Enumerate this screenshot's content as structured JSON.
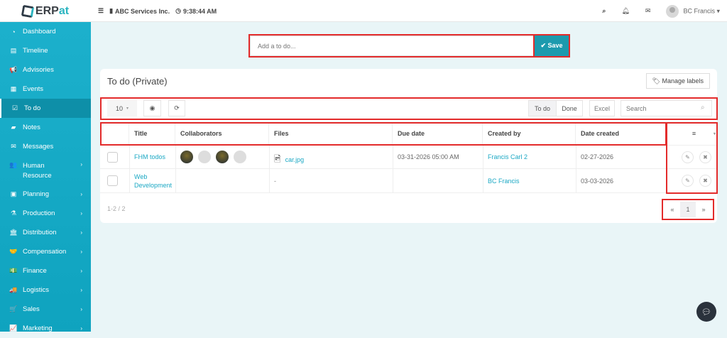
{
  "app": {
    "logo_prefix": "ERP",
    "logo_suffix": "at",
    "company": "ABC Services Inc.",
    "time": "9:38:44 AM",
    "user": "BC Francis"
  },
  "sidebar": {
    "items": [
      {
        "label": "Dashboard",
        "icon": "dashboard-icon",
        "glyph": "◔"
      },
      {
        "label": "Timeline",
        "icon": "timeline-icon",
        "glyph": "▤"
      },
      {
        "label": "Advisories",
        "icon": "megaphone-icon",
        "glyph": "📢"
      },
      {
        "label": "Events",
        "icon": "calendar-icon",
        "glyph": "▦"
      },
      {
        "label": "To do",
        "icon": "check-square-icon",
        "glyph": "☑"
      },
      {
        "label": "Notes",
        "icon": "note-icon",
        "glyph": "▰"
      },
      {
        "label": "Messages",
        "icon": "envelope-icon",
        "glyph": "✉"
      },
      {
        "label": "Human Resource",
        "icon": "users-icon",
        "glyph": "👥"
      },
      {
        "label": "Planning",
        "icon": "briefcase-icon",
        "glyph": "▣"
      },
      {
        "label": "Production",
        "icon": "flask-icon",
        "glyph": "⚗"
      },
      {
        "label": "Distribution",
        "icon": "bank-icon",
        "glyph": "🏛"
      },
      {
        "label": "Compensation",
        "icon": "handshake-icon",
        "glyph": "🤝"
      },
      {
        "label": "Finance",
        "icon": "money-icon",
        "glyph": "💵"
      },
      {
        "label": "Logistics",
        "icon": "truck-icon",
        "glyph": "🚚"
      },
      {
        "label": "Sales",
        "icon": "cart-icon",
        "glyph": "🛒"
      },
      {
        "label": "Marketing",
        "icon": "chart-line-icon",
        "glyph": "📈"
      }
    ]
  },
  "todo_input": {
    "placeholder": "Add a to do...",
    "save_label": "Save"
  },
  "card": {
    "title": "To do (Private)",
    "manage_labels": "Manage labels"
  },
  "toolbar": {
    "page_size": "10",
    "todo_tab": "To do",
    "done_tab": "Done",
    "excel": "Excel",
    "search_placeholder": "Search"
  },
  "table": {
    "columns": [
      "Title",
      "Collaborators",
      "Files",
      "Due date",
      "Created by",
      "Date created"
    ],
    "rows": [
      {
        "title": "FHM todos",
        "file": "car.jpg",
        "due": "03-31-2026 05:00 AM",
        "created_by": "Francis Carl 2",
        "date_created": "02-27-2026"
      },
      {
        "title": "Web Development",
        "file": "-",
        "due": "",
        "created_by": "BC Francis",
        "date_created": "03-03-2026"
      }
    ]
  },
  "footer": {
    "summary": "1-2 / 2",
    "page": "1",
    "prev": "«",
    "next": "»"
  },
  "colors": {
    "sidebar": "#1cb0cc",
    "accent": "#1c9aae",
    "link": "#1ba8c4",
    "annotation": "#e32b2b"
  }
}
